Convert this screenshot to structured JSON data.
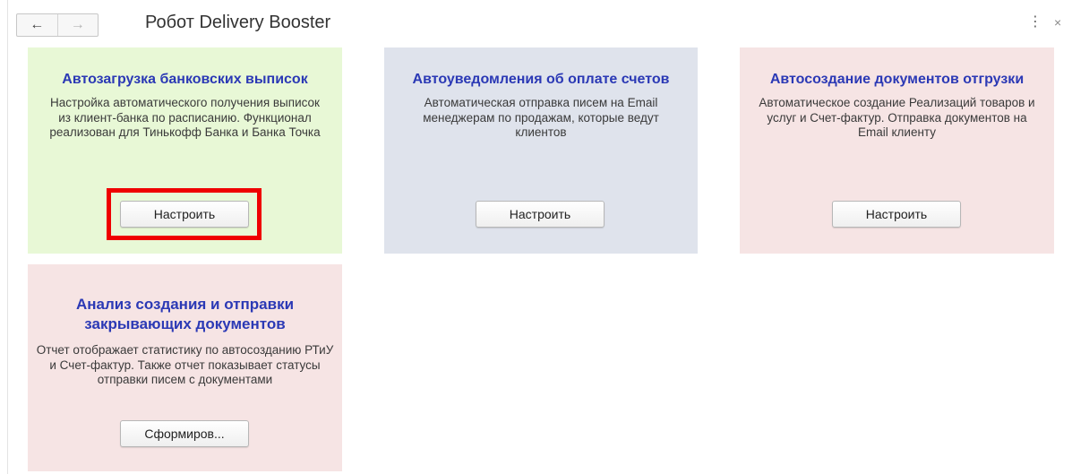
{
  "header": {
    "back_icon": "←",
    "forward_icon": "→",
    "title": "Робот Delivery Booster",
    "more_icon": "⋮",
    "close_icon": "×"
  },
  "cards": [
    {
      "title": "Автозагрузка банковских выписок",
      "description": "Настройка автоматического получения выписок из клиент-банка по расписанию. Функционал реализован для Тинькофф Банка и Банка Точка",
      "button": "Настроить",
      "color": "#e8f8d6",
      "highlighted": true
    },
    {
      "title": "Автоуведомления об оплате счетов",
      "description": "Автоматическая отправка писем на Email менеджерам по продажам, которые ведут клиентов",
      "button": "Настроить",
      "color": "#dfe3ec"
    },
    {
      "title": "Автосоздание документов отгрузки",
      "description": "Автоматическое создание Реализаций товаров и услуг и Счет-фактур. Отправка документов на Email клиенту",
      "button": "Настроить",
      "color": "#f6e4e4"
    },
    {
      "title": "Анализ создания и отправки закрывающих документов",
      "description": "Отчет отображает статистику по автосозданию РТиУ и Счет-фактур. Также отчет показывает статусы отправки писем с документами",
      "button": "Сформиров...",
      "color": "#f6e4e4"
    }
  ],
  "highlight_color": "#ef0000"
}
